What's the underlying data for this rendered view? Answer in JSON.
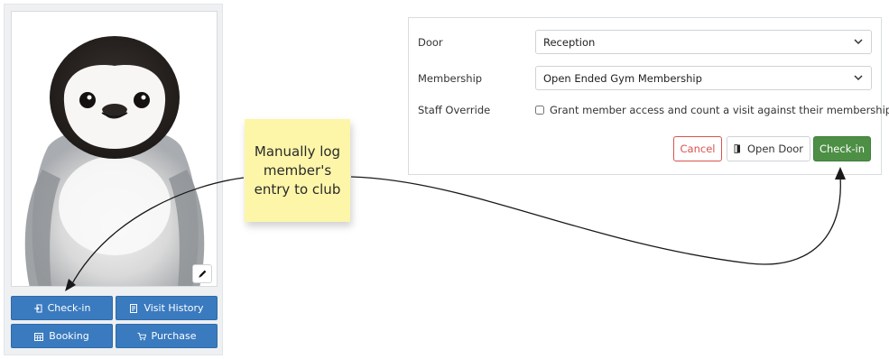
{
  "member_card": {
    "photo_alt": "",
    "buttons": {
      "checkin": "Check-in",
      "visit_history": "Visit History",
      "booking": "Booking",
      "purchase": "Purchase"
    }
  },
  "sticky_note": {
    "line1": "Manually log",
    "line2": "member's",
    "line3": "entry to club"
  },
  "checkin_form": {
    "door_label": "Door",
    "door_value": "Reception",
    "membership_label": "Membership",
    "membership_value": "Open Ended Gym Membership",
    "override_label": "Staff Override",
    "override_text": "Grant member access and count a visit against their membership.",
    "override_checked": false,
    "cancel_label": "Cancel",
    "open_door_label": "Open Door",
    "checkin_label": "Check-in"
  },
  "colors": {
    "primary_blue": "#3a7abf",
    "success_green": "#4d8f45",
    "danger_red": "#d9534f",
    "sticky_yellow": "#fdf6a9"
  },
  "icons": {
    "checkin": "sign-in-icon",
    "visit_history": "history-icon",
    "booking": "calendar-icon",
    "purchase": "cart-icon",
    "edit_photo": "pencil-icon",
    "open_door": "door-icon",
    "dropdown": "chevron-down-icon"
  }
}
